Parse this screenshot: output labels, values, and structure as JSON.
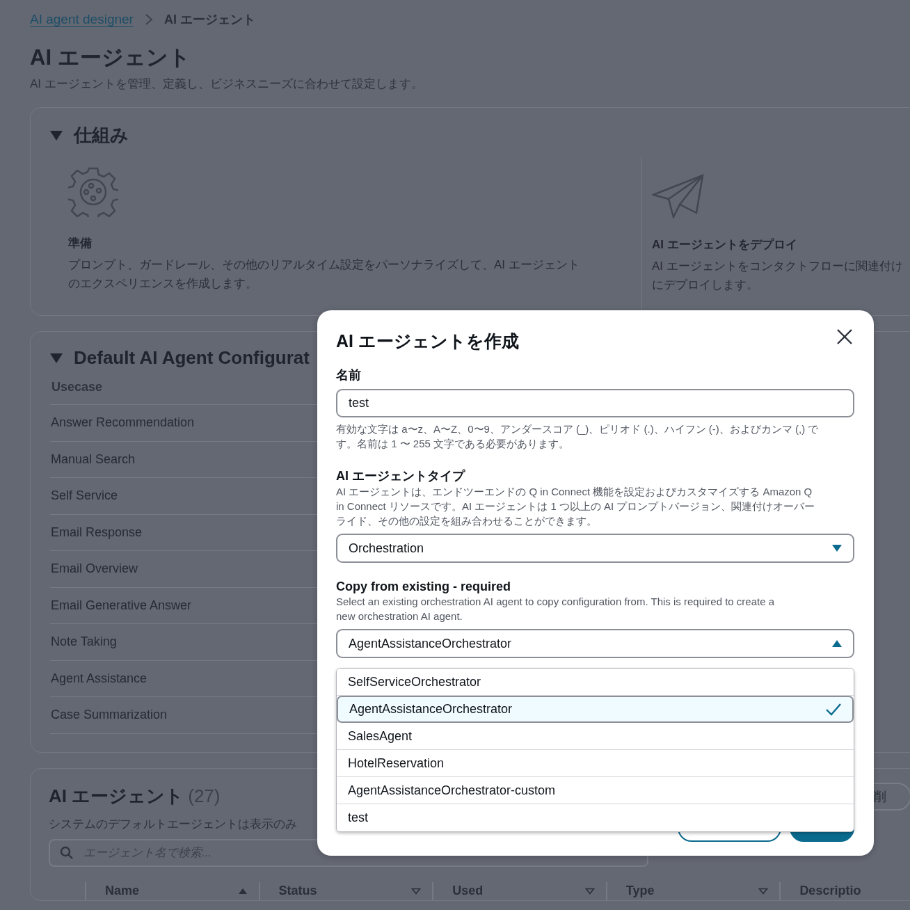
{
  "breadcrumb": [
    {
      "label": "AI agent designer",
      "kind": "link"
    },
    {
      "label": "AI エージェント",
      "kind": "current"
    }
  ],
  "page": {
    "title": "AI エージェント",
    "subtitle": "AI エージェントを管理、定義し、ビジネスニーズに合わせて設定します。"
  },
  "how_it_works": {
    "title": "仕組み",
    "expanded": true,
    "steps": [
      {
        "kind": "gear",
        "title": "準備",
        "description": "プロンプト、ガードレール、その他のリアルタイム設定をパーソナライズして、AI エージェントのエクスペリエンスを作成します。"
      },
      {
        "kind": "plane",
        "title": "AI エージェントをデプロイ",
        "description": "AI エージェントをコンタクトフローに関連付けにデプロイします。"
      }
    ]
  },
  "default_config": {
    "title": "Default AI Agent Configurat",
    "expanded": true,
    "column": "Usecase",
    "rows": [
      "Answer Recommendation",
      "Manual Search",
      "Self Service",
      "Email Response",
      "Email Overview",
      "Email Generative Answer",
      "Note Taking",
      "Agent Assistance",
      "Case Summarization"
    ]
  },
  "agents": {
    "title": "AI エージェント",
    "count": "(27)",
    "subtitle": "システムのデフォルトエージェントは表示のみ",
    "search_placeholder": "エージェント名で検索...",
    "action_button": "削",
    "columns": [
      {
        "label": "Name",
        "sorted": true
      },
      {
        "label": "Status",
        "sorted": false
      },
      {
        "label": "Used",
        "sorted": false
      },
      {
        "label": "Type",
        "sorted": false
      },
      {
        "label": "Descriptio"
      }
    ]
  },
  "modal": {
    "title": "AI エージェントを作成",
    "name_field": {
      "label": "名前",
      "value": "test",
      "hint": "有効な文字は a〜z、A〜Z、0〜9、アンダースコア (_)、ピリオド (.)、ハイフン (-)、およびカンマ (,) です。名前は 1 〜 255 文字である必要があります。"
    },
    "type_field": {
      "label": "AI エージェントタイプ",
      "description": "AI エージェントは、エンドツーエンドの Q in Connect 機能を設定およびカスタマイズする Amazon Q in Connect リソースです。AI エージェントは 1 つ以上の AI プロンプトバージョン、関連付けオーバーライド、その他の設定を組み合わせることができます。",
      "value": "Orchestration",
      "expanded": false
    },
    "copy_field": {
      "label": "Copy from existing - required",
      "description": "Select an existing orchestration AI agent to copy configuration from. This is required to create a new orchestration AI agent.",
      "value": "AgentAssistanceOrchestrator",
      "expanded": true,
      "options": [
        {
          "label": "SelfServiceOrchestrator",
          "selected": false
        },
        {
          "label": "AgentAssistanceOrchestrator",
          "selected": true
        },
        {
          "label": "SalesAgent",
          "selected": false
        },
        {
          "label": "HotelReservation",
          "selected": false
        },
        {
          "label": "AgentAssistanceOrchestrator-custom",
          "selected": false
        },
        {
          "label": "test",
          "selected": false
        }
      ]
    },
    "footer_buttons": [
      {
        "kind": "secondary"
      },
      {
        "kind": "primary"
      }
    ]
  }
}
